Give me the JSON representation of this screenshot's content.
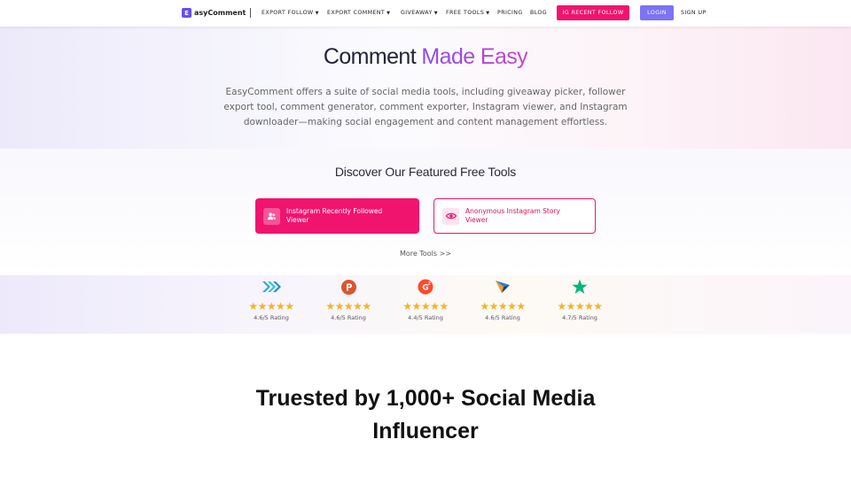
{
  "nav": {
    "logo_mark": "E",
    "logo_text": "asyComment",
    "items": [
      {
        "label": "EXPORT FOLLOW",
        "dropdown": true
      },
      {
        "label": "EXPORT COMMENT",
        "dropdown": true
      },
      {
        "label": "GIVEAWAY",
        "dropdown": true
      },
      {
        "label": "FREE TOOLS",
        "dropdown": true
      },
      {
        "label": "PRICING",
        "dropdown": false
      },
      {
        "label": "BLOG",
        "dropdown": false
      }
    ],
    "ig_button": "IG RECENT FOLLOW",
    "login": "LOGIN",
    "signup": "SIGN UP"
  },
  "hero": {
    "title_plain": "Comment ",
    "title_accent": "Made Easy",
    "description": "EasyComment offers a suite of social media tools, including giveaway picker, follower export tool, comment generator, comment exporter, Instagram viewer, and Instagram downloader—making social engagement and content management effortless."
  },
  "featured": {
    "title": "Discover Our Featured Free Tools",
    "tools": [
      {
        "label": "Instagram Recently Followed Viewer",
        "icon": "users-icon"
      },
      {
        "label": "Anonymous Instagram Story Viewer",
        "icon": "eye-icon"
      }
    ],
    "more_link": "More Tools >>"
  },
  "ratings": [
    {
      "platform_icon": "capterra-icon",
      "stars": "★★★★★",
      "text": "4.6/5 Rating",
      "score": 4.6
    },
    {
      "platform_icon": "producthunt-icon",
      "stars": "★★★★★",
      "text": "4.6/5 Rating",
      "score": 4.6
    },
    {
      "platform_icon": "g2-icon",
      "stars": "★★★★★",
      "text": "4.4/5 Rating",
      "score": 4.4
    },
    {
      "platform_icon": "getapp-icon",
      "stars": "★★★★★",
      "text": "4.6/5 Rating",
      "score": 4.6
    },
    {
      "platform_icon": "trustpilot-icon",
      "stars": "★★★★★",
      "text": "4.7/5 Rating",
      "score": 4.7
    }
  ],
  "trusted": {
    "line1": "Truested by 1,000+ Social Media",
    "line2": "Influencer"
  },
  "colors": {
    "brand_pink": "#f0146f",
    "login_purple": "#7c73f5",
    "accent_gradient_start": "#8a4cf0",
    "accent_gradient_end": "#c846c6",
    "star": "#f5b324"
  }
}
